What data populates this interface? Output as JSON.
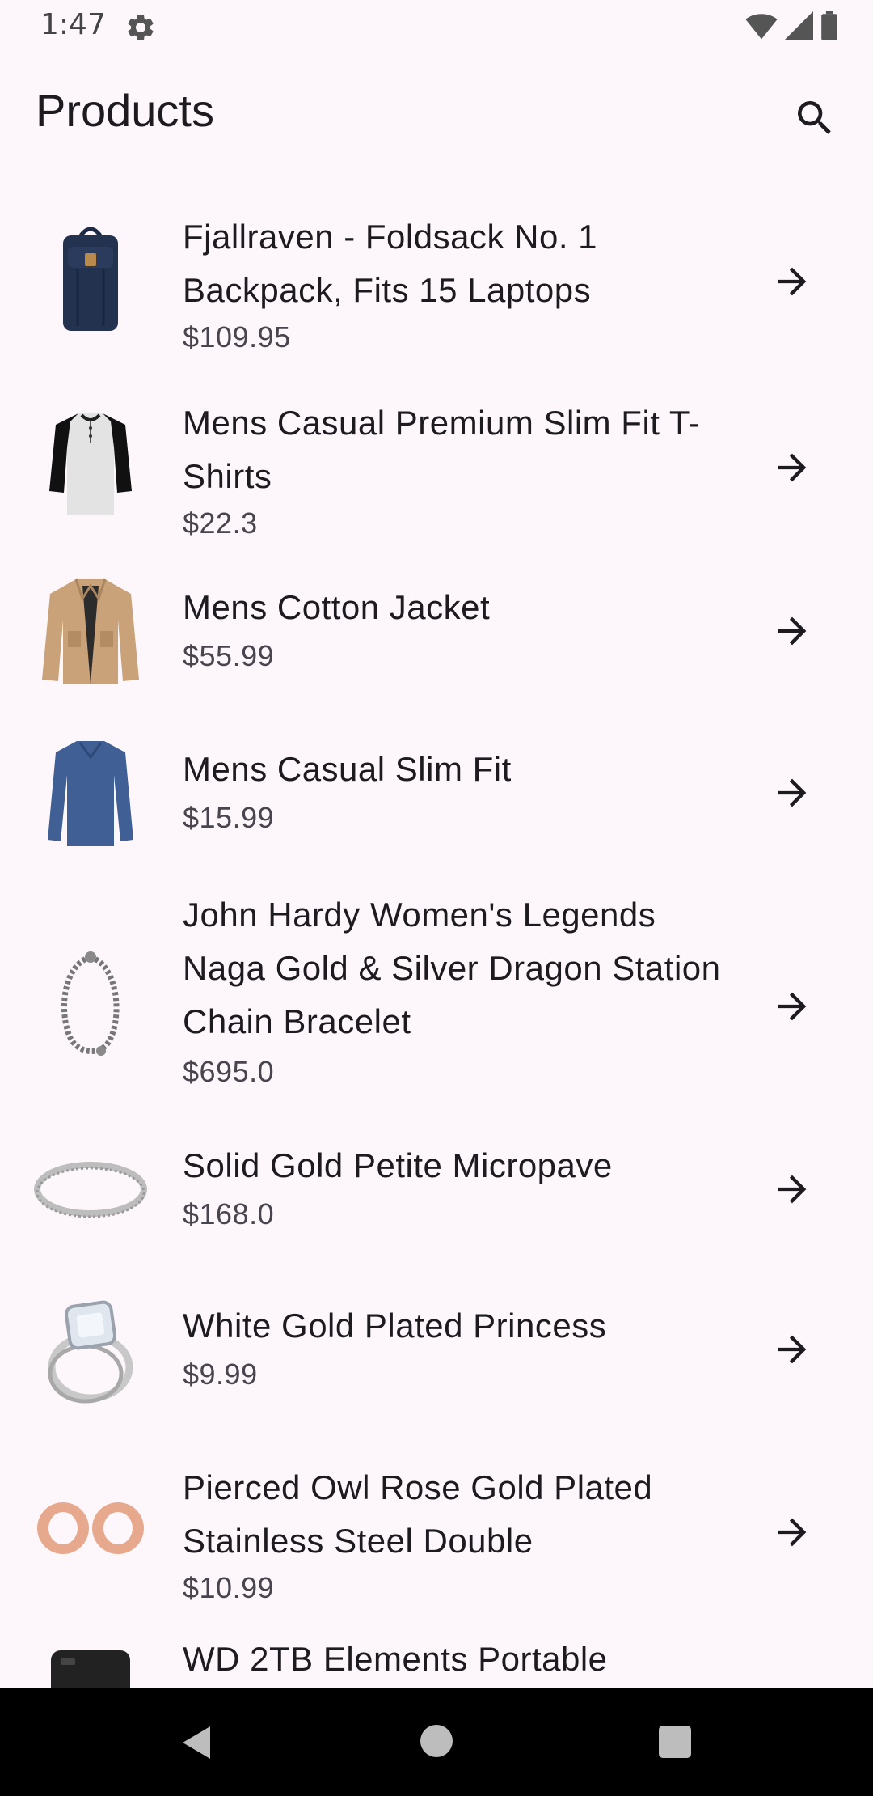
{
  "status_bar": {
    "time": "1:47",
    "icons": [
      "gear-icon",
      "wifi-icon",
      "signal-icon",
      "battery-icon"
    ]
  },
  "app_bar": {
    "title": "Products",
    "search_icon": "search-icon"
  },
  "colors": {
    "background": "#fdf7fc",
    "title_text": "#1d1b20",
    "price_text": "#49454f",
    "nav_bar": "#000000"
  },
  "products": [
    {
      "title": "Fjallraven - Foldsack No. 1 Backpack, Fits 15 Laptops",
      "price": "$109.95",
      "image": "backpack"
    },
    {
      "title": "Mens Casual Premium Slim Fit T-Shirts",
      "price": "$22.3",
      "image": "raglan-tshirt"
    },
    {
      "title": "Mens Cotton Jacket",
      "price": "$55.99",
      "image": "jacket"
    },
    {
      "title": "Mens Casual Slim Fit",
      "price": "$15.99",
      "image": "longsleeve-shirt"
    },
    {
      "title": "John Hardy Women's Legends Naga Gold & Silver Dragon Station Chain Bracelet",
      "price": "$695.0",
      "image": "bracelet"
    },
    {
      "title": "Solid Gold Petite Micropave",
      "price": "$168.0",
      "image": "ring-band"
    },
    {
      "title": "White Gold Plated Princess",
      "price": "$9.99",
      "image": "engagement-ring"
    },
    {
      "title": "Pierced Owl Rose Gold Plated Stainless Steel Double",
      "price": "$10.99",
      "image": "ear-plugs"
    },
    {
      "title": "WD 2TB Elements Portable",
      "price": "",
      "image": "hard-drive"
    }
  ],
  "nav_bar": {
    "back_icon": "back-icon",
    "home_icon": "home-icon",
    "recents_icon": "recents-icon"
  }
}
